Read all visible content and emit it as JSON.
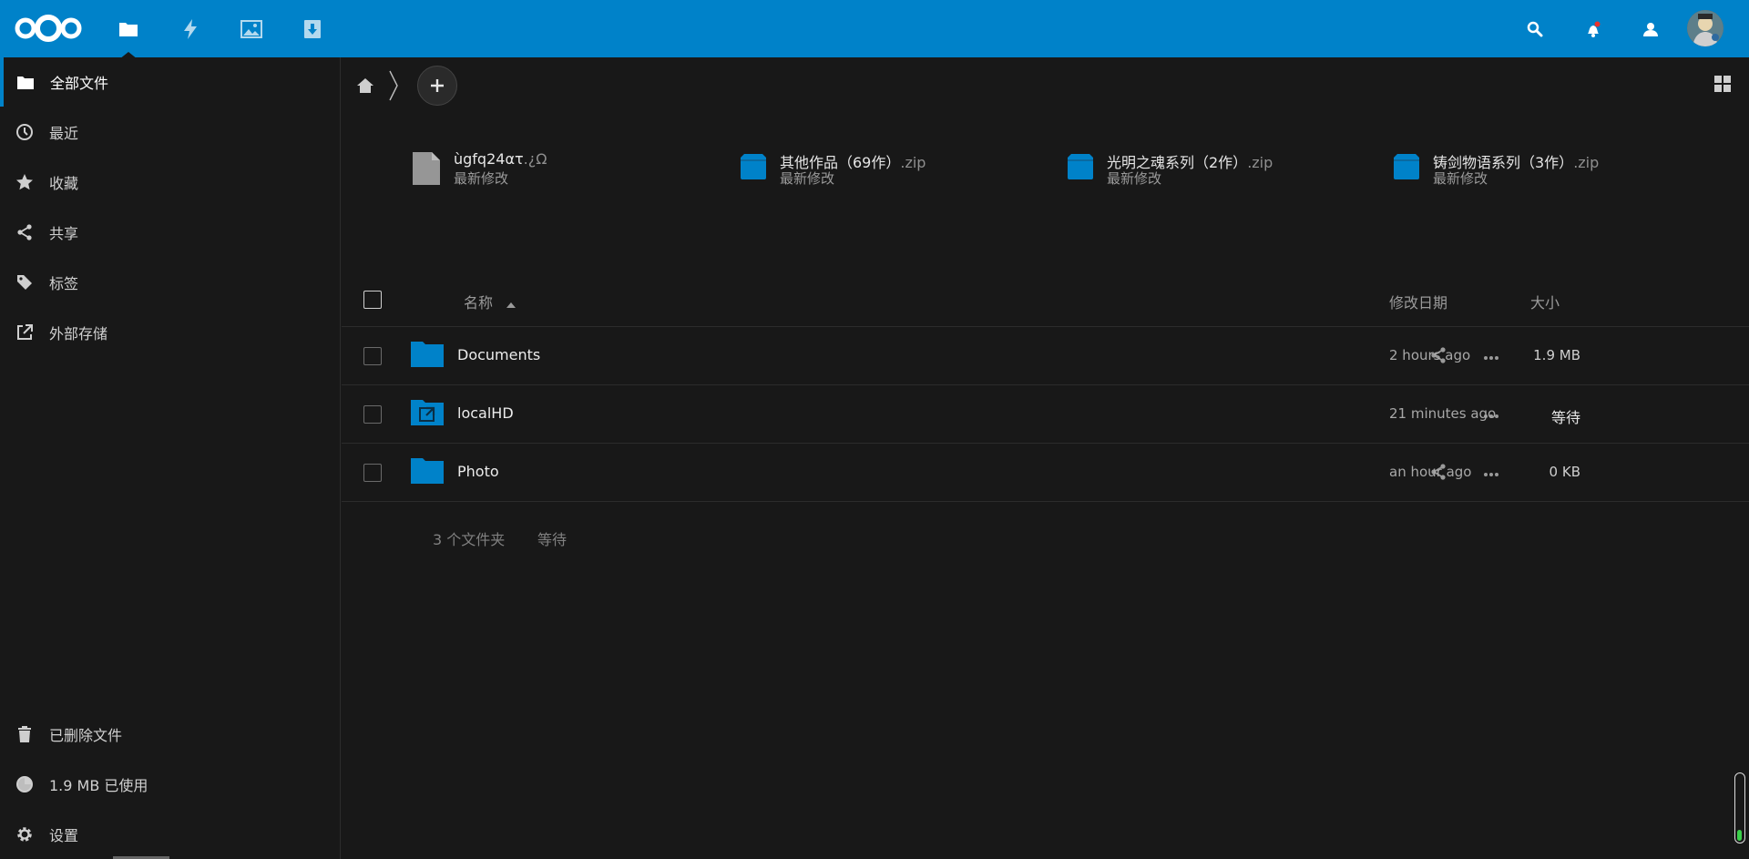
{
  "header": {
    "apps": [
      {
        "name": "files-app-icon",
        "icon": "folder-icon"
      },
      {
        "name": "activity-app-icon",
        "icon": "lightning-icon"
      },
      {
        "name": "gallery-app-icon",
        "icon": "image-icon"
      },
      {
        "name": "downloads-app-icon",
        "icon": "download-icon"
      }
    ],
    "right_icons": [
      "search-icon",
      "notifications-icon",
      "contacts-icon"
    ],
    "accent": "#0082c9"
  },
  "sidebar": {
    "items": [
      {
        "label": "全部文件",
        "icon": "folder-icon",
        "active": true
      },
      {
        "label": "最近",
        "icon": "clock-icon"
      },
      {
        "label": "收藏",
        "icon": "star-icon"
      },
      {
        "label": "共享",
        "icon": "share-icon"
      },
      {
        "label": "标签",
        "icon": "tag-icon"
      },
      {
        "label": "外部存储",
        "icon": "external-link-icon"
      }
    ],
    "bottom": {
      "trash": "已删除文件",
      "quota": "1.9 MB 已使用",
      "settings": "设置"
    }
  },
  "recent": [
    {
      "name": "ùgfq24ατ",
      "ext": ".¿Ω",
      "sub": "最新修改",
      "icon": "file-icon"
    },
    {
      "name": "其他作品（69作）",
      "ext": ".zip",
      "sub": "最新修改",
      "icon": "zip-icon"
    },
    {
      "name": "光明之魂系列（2作）",
      "ext": ".zip",
      "sub": "最新修改",
      "icon": "zip-icon"
    },
    {
      "name": "铸剑物语系列（3作）",
      "ext": ".zip",
      "sub": "最新修改",
      "icon": "zip-icon"
    }
  ],
  "table": {
    "columns": {
      "name": "名称",
      "size": "大小",
      "modified": "修改日期"
    },
    "rows": [
      {
        "name": "Documents",
        "size": "1.9 MB",
        "modified": "2 hours ago",
        "shared": true,
        "type": "folder"
      },
      {
        "name": "localHD",
        "size": "等待",
        "modified": "21 minutes ago",
        "shared": false,
        "type": "external-folder"
      },
      {
        "name": "Photo",
        "size": "0 KB",
        "modified": "an hour ago",
        "shared": true,
        "type": "folder"
      }
    ],
    "summary": {
      "count": "3 个文件夹",
      "size": "等待"
    }
  }
}
